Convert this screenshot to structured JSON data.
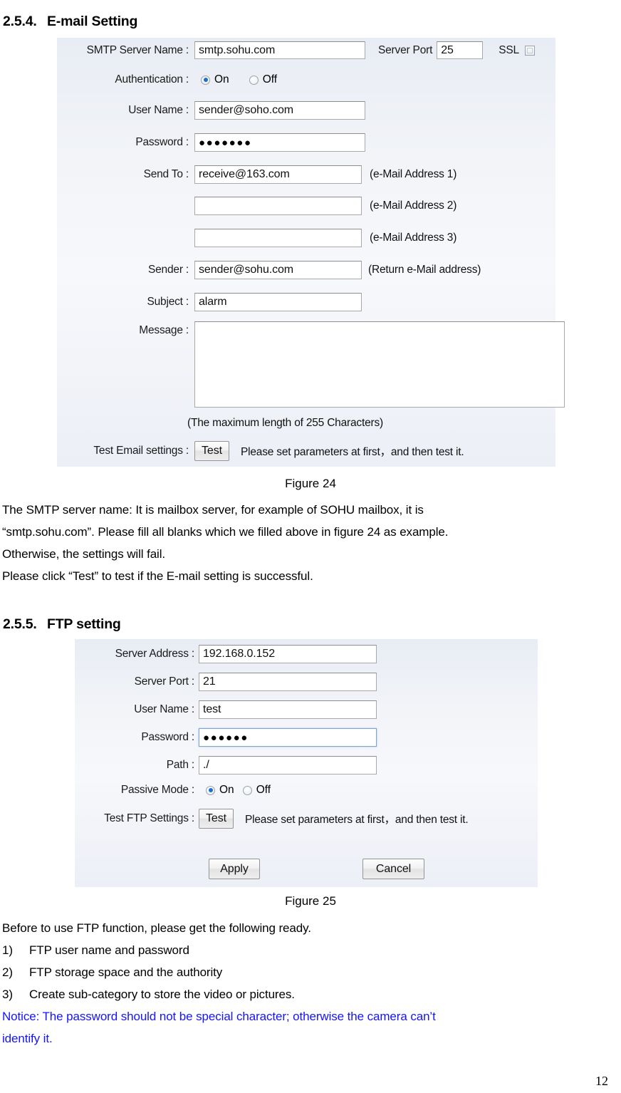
{
  "document": {
    "page_number": "12"
  },
  "email_section": {
    "number": "2.5.4.",
    "title": "E-mail Setting",
    "figure_caption": "Figure 24",
    "form": {
      "smtp_server_label": "SMTP Server Name :",
      "smtp_server_value": "smtp.sohu.com",
      "server_port_label": "Server Port",
      "server_port_value": "25",
      "ssl_label": "SSL",
      "authentication_label": "Authentication :",
      "auth_on_label": "On",
      "auth_off_label": "Off",
      "auth_selected": "On",
      "user_name_label": "User Name :",
      "user_name_value": "sender@soho.com",
      "password_label": "Password :",
      "password_value": "●●●●●●●",
      "send_to_label": "Send To :",
      "send_to_1_value": "receive@163.com",
      "send_to_1_hint": "(e-Mail Address 1)",
      "send_to_2_value": "",
      "send_to_2_hint": "(e-Mail Address 2)",
      "send_to_3_value": "",
      "send_to_3_hint": "(e-Mail Address 3)",
      "sender_label": "Sender :",
      "sender_value": "sender@sohu.com",
      "sender_hint": "(Return e-Mail address)",
      "subject_label": "Subject :",
      "subject_value": "alarm",
      "message_label": "Message :",
      "message_value": "",
      "max_length_note": "(The maximum length of 255 Characters)",
      "test_email_label": "Test Email settings :",
      "test_button_label": "Test",
      "test_hint": "Please set parameters at first，and then test it."
    },
    "paragraphs": [
      "The SMTP server name: It is mailbox server, for example of SOHU mailbox, it is",
      "“smtp.sohu.com”. Please fill all blanks which we filled above in figure 24 as example.",
      "Otherwise, the settings will fail.",
      "Please click “Test” to test if the E-mail setting is successful."
    ]
  },
  "ftp_section": {
    "number": "2.5.5.",
    "title": "FTP setting",
    "figure_caption": "Figure 25",
    "form": {
      "server_address_label": "Server Address :",
      "server_address_value": "192.168.0.152",
      "server_port_label": "Server Port :",
      "server_port_value": "21",
      "user_name_label": "User Name :",
      "user_name_value": "test",
      "password_label": "Password :",
      "password_value": "●●●●●●",
      "path_label": "Path :",
      "path_value": "./",
      "passive_mode_label": "Passive Mode :",
      "passive_on_label": "On",
      "passive_off_label": "Off",
      "passive_selected": "On",
      "test_ftp_label": "Test FTP Settings :",
      "test_button_label": "Test",
      "test_hint": "Please set parameters at first，and then test it.",
      "apply_button_label": "Apply",
      "cancel_button_label": "Cancel"
    },
    "intro": "Before to use FTP function, please get the following ready.",
    "list": [
      {
        "marker": "1)",
        "text": "FTP user name and password"
      },
      {
        "marker": "2)",
        "text": "FTP storage space and the authority"
      },
      {
        "marker": "3)",
        "text": "Create sub-category to store the video or pictures."
      }
    ],
    "notice_lines": [
      "Notice: The password should not be special character; otherwise the camera can’t",
      "identify it."
    ],
    "notice_color": "#1414ff"
  }
}
